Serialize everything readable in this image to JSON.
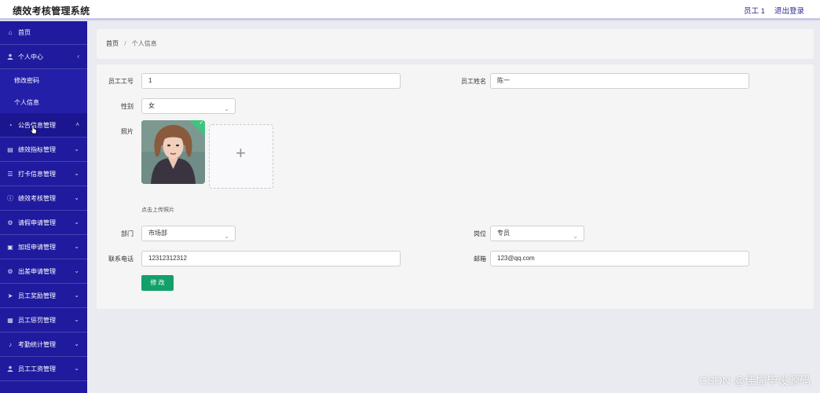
{
  "app": {
    "title": "绩效考核管理系统"
  },
  "header": {
    "user_label": "员工 1",
    "logout_label": "退出登录"
  },
  "sidebar": {
    "items": [
      {
        "label": "首页",
        "icon": "home-icon"
      },
      {
        "label": "个人中心",
        "icon": "user-icon",
        "expanded": true
      },
      {
        "label": "修改密码",
        "sub": true
      },
      {
        "label": "个人信息",
        "sub": true
      },
      {
        "label": "公告信息管理",
        "icon": "clock-icon"
      },
      {
        "label": "绩效指标管理",
        "icon": "list-icon"
      },
      {
        "label": "打卡信息管理",
        "icon": "menu-icon"
      },
      {
        "label": "绩效考核管理",
        "icon": "info-icon"
      },
      {
        "label": "请假申请管理",
        "icon": "gear-icon"
      },
      {
        "label": "加班申请管理",
        "icon": "lock-icon"
      },
      {
        "label": "出差申请管理",
        "icon": "settings-icon"
      },
      {
        "label": "员工奖励管理",
        "icon": "send-icon"
      },
      {
        "label": "员工惩罚管理",
        "icon": "doc-icon"
      },
      {
        "label": "考勤统计管理",
        "icon": "mic-icon"
      },
      {
        "label": "员工工资管理",
        "icon": "person-icon"
      }
    ]
  },
  "breadcrumb": {
    "home": "首页",
    "sep": "/",
    "current": "个人信息"
  },
  "form": {
    "employee_id_label": "员工工号",
    "employee_id_value": "1",
    "employee_name_label": "员工姓名",
    "employee_name_value": "陈一",
    "gender_label": "性别",
    "gender_value": "女",
    "photo_label": "照片",
    "upload_hint": "点击上传照片",
    "department_label": "部门",
    "department_value": "市场部",
    "position_label": "岗位",
    "position_value": "专员",
    "phone_label": "联系电话",
    "phone_value": "12312312312",
    "email_label": "邮箱",
    "email_value": "123@qq.com",
    "submit_label": "修 改"
  },
  "watermark": "CSDN @佳愉毕设源码",
  "colors": {
    "sidebar": "#1f1a9e",
    "accent": "#14a06b",
    "badge": "#3ec47e"
  }
}
